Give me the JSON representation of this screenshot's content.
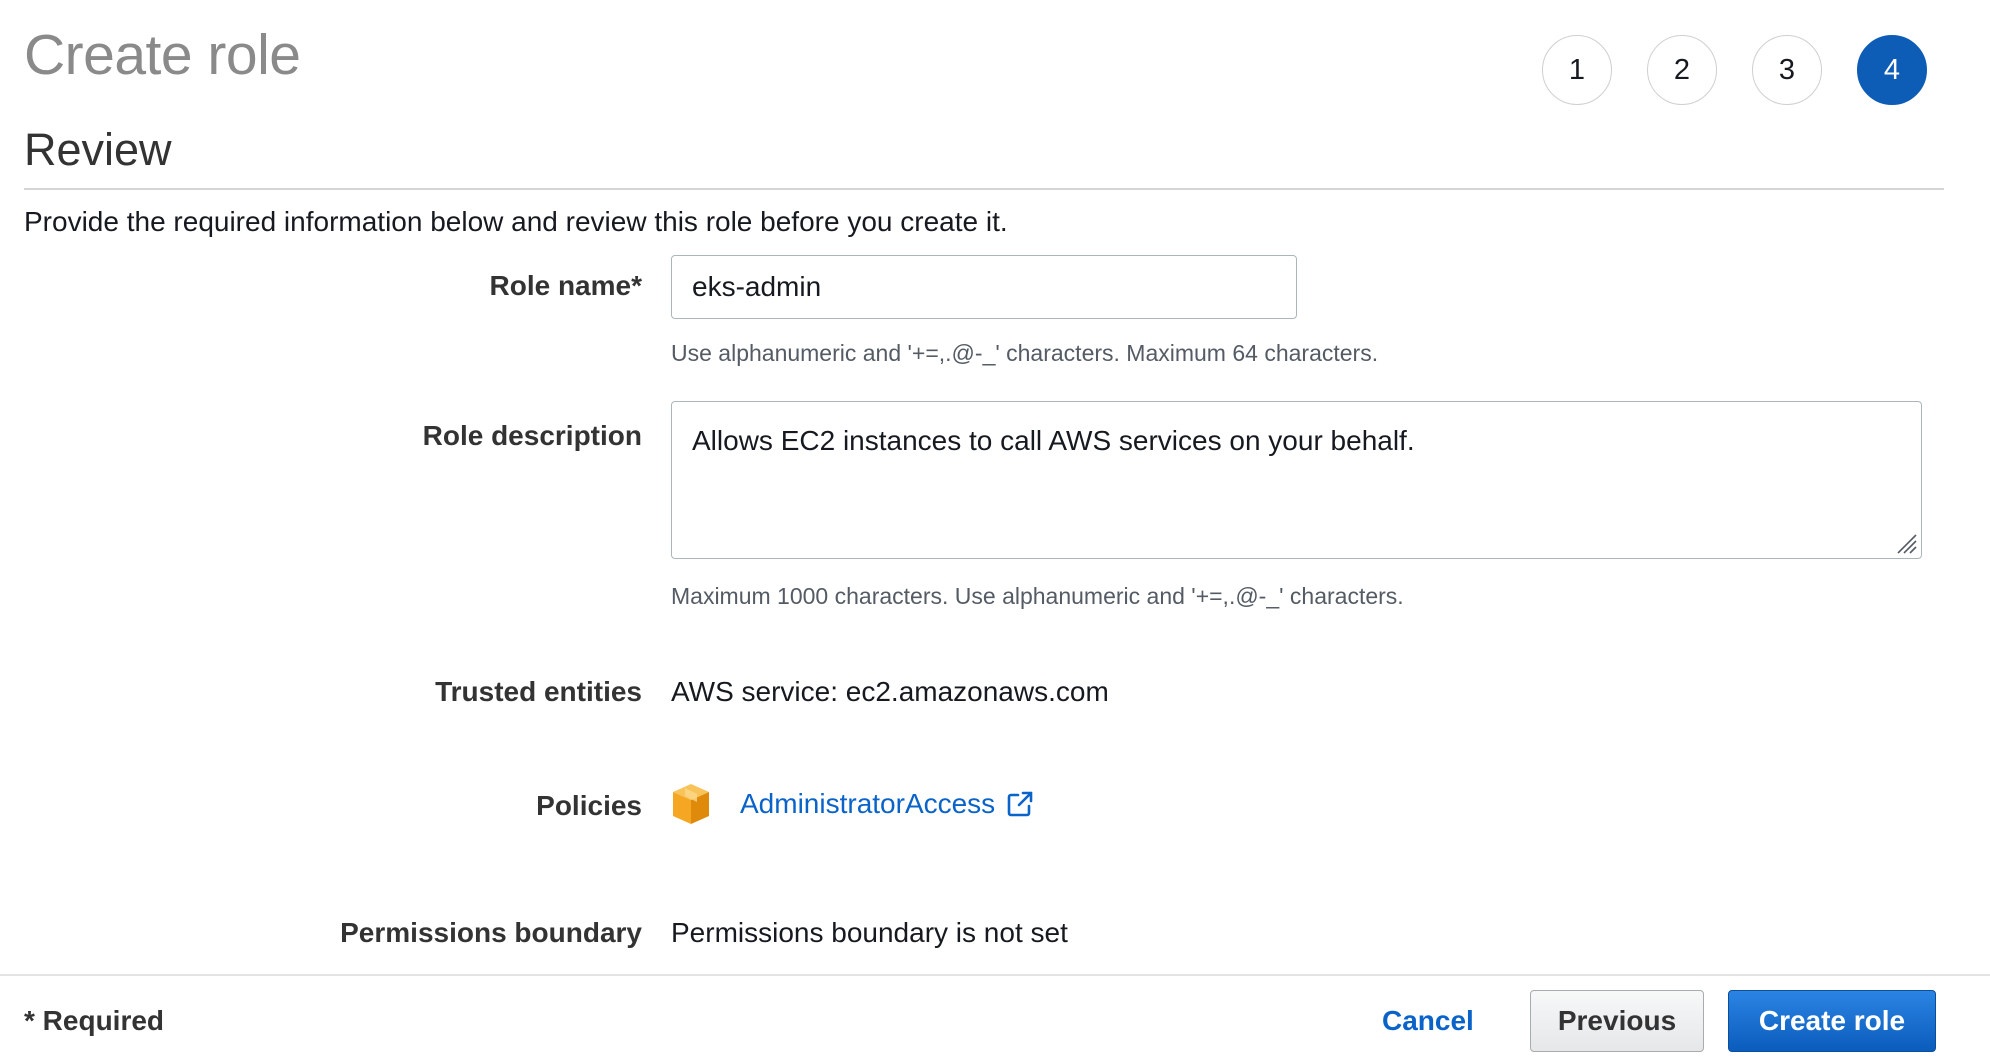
{
  "header": {
    "title": "Create role",
    "steps": [
      "1",
      "2",
      "3",
      "4"
    ],
    "active_step": "4"
  },
  "review": {
    "title": "Review",
    "intro": "Provide the required information below and review this role before you create it."
  },
  "form": {
    "role_name": {
      "label": "Role name*",
      "value": "eks-admin",
      "hint": "Use alphanumeric and '+=,.@-_' characters. Maximum 64 characters."
    },
    "role_description": {
      "label": "Role description",
      "value": "Allows EC2 instances to call AWS services on your behalf.",
      "hint": "Maximum 1000 characters. Use alphanumeric and '+=,.@-_' characters."
    },
    "trusted_entities": {
      "label": "Trusted entities",
      "value": "AWS service: ec2.amazonaws.com"
    },
    "policies": {
      "label": "Policies",
      "items": [
        {
          "name": "AdministratorAccess",
          "icon": "policy-box-icon",
          "link_icon": "external-link-icon"
        }
      ]
    },
    "permissions_boundary": {
      "label": "Permissions boundary",
      "value": "Permissions boundary is not set"
    }
  },
  "footer": {
    "required_note": "* Required",
    "cancel_label": "Cancel",
    "previous_label": "Previous",
    "create_label": "Create role"
  },
  "colors": {
    "accent": "#0d5cb6",
    "link": "#0a63c9",
    "policy_icon": "#f5a623"
  }
}
